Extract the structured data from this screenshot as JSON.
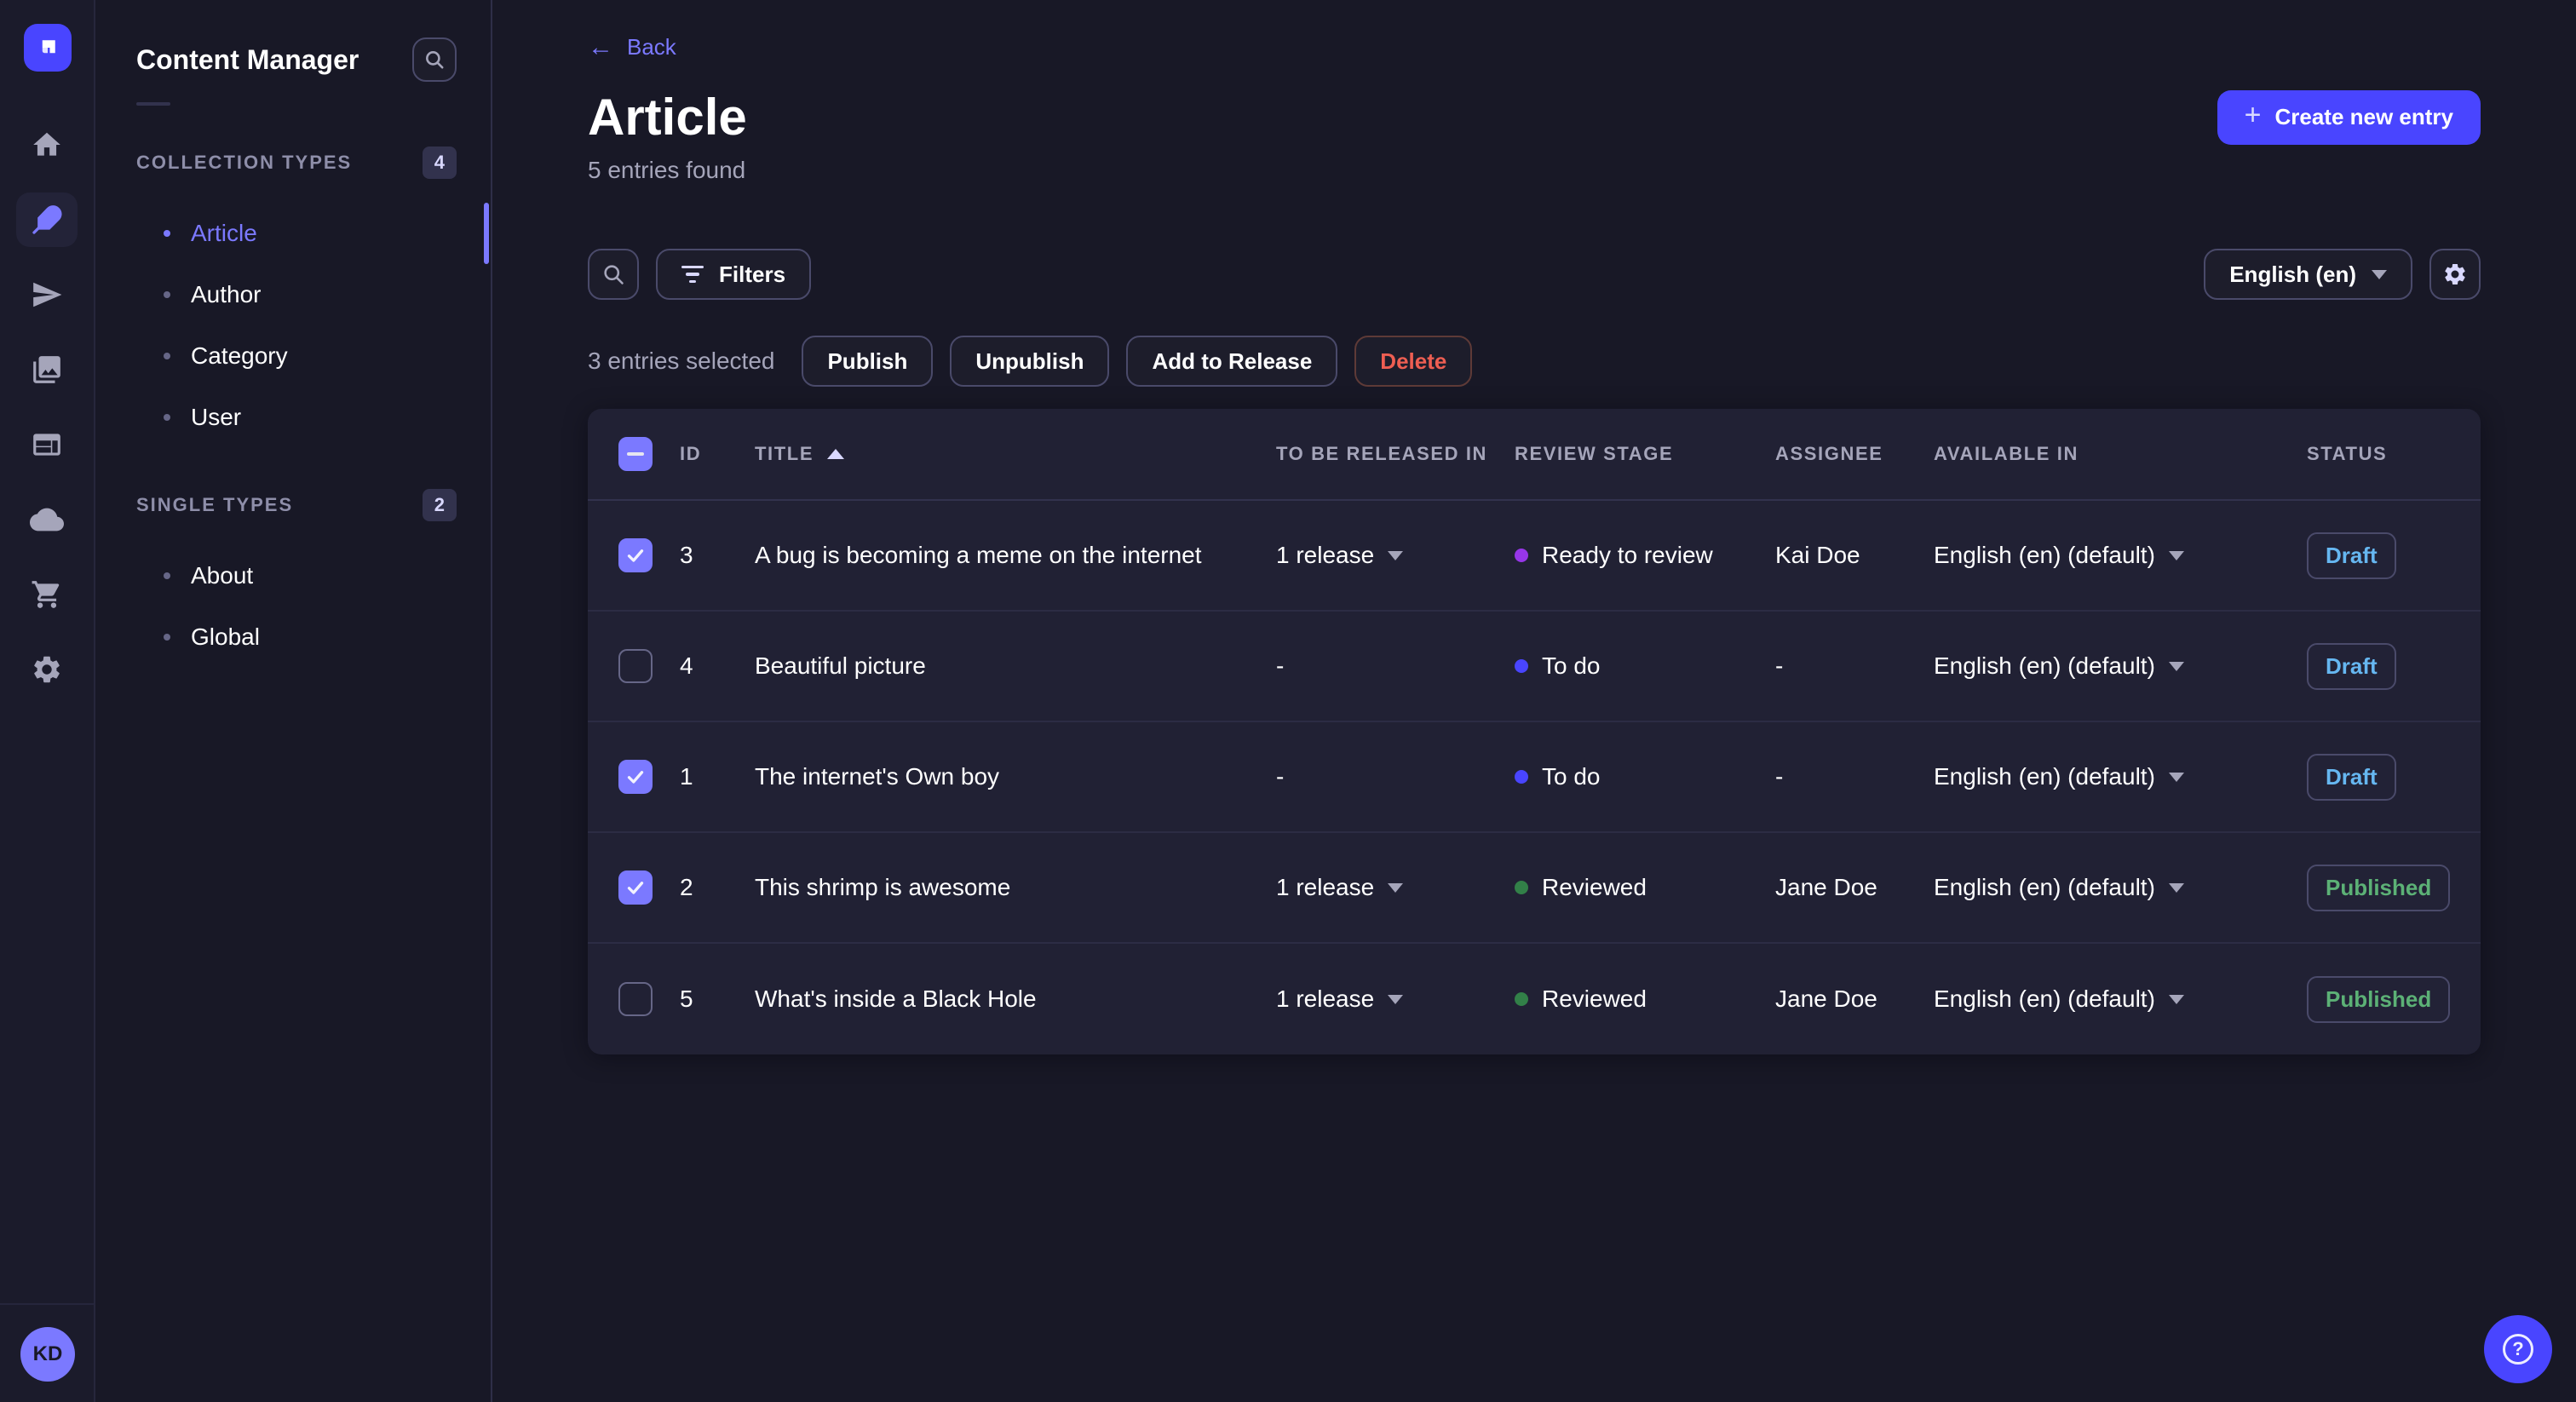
{
  "colors": {
    "accent": "#4945ff",
    "accent_light": "#7b79ff",
    "page_bg": "#181826",
    "card_bg": "#212134",
    "border": "#32324d",
    "text_muted": "#a5a5ba",
    "draft_text": "#66b7f1",
    "published_text": "#5cb176",
    "danger_text": "#ee5e52"
  },
  "nav": {
    "icons": [
      "home",
      "content-manager",
      "releases",
      "media-library",
      "content-type-builder",
      "deploy",
      "marketplace",
      "settings"
    ],
    "active_icon": "content-manager",
    "avatar": "KD"
  },
  "sidebar": {
    "title": "Content Manager",
    "sections": [
      {
        "label": "COLLECTION TYPES",
        "count": "4",
        "items": [
          {
            "label": "Article",
            "active": true
          },
          {
            "label": "Author",
            "active": false
          },
          {
            "label": "Category",
            "active": false
          },
          {
            "label": "User",
            "active": false
          }
        ]
      },
      {
        "label": "SINGLE TYPES",
        "count": "2",
        "items": [
          {
            "label": "About",
            "active": false
          },
          {
            "label": "Global",
            "active": false
          }
        ]
      }
    ]
  },
  "header": {
    "back": "Back",
    "title": "Article",
    "subtitle": "5 entries found",
    "create_button": "Create new entry"
  },
  "toolbar": {
    "filters": "Filters",
    "locale": "English (en)"
  },
  "selection": {
    "text": "3 entries selected",
    "actions": [
      {
        "label": "Publish",
        "danger": false
      },
      {
        "label": "Unpublish",
        "danger": false
      },
      {
        "label": "Add to Release",
        "danger": false
      },
      {
        "label": "Delete",
        "danger": true
      }
    ]
  },
  "table": {
    "columns": [
      "ID",
      "TITLE",
      "TO BE RELEASED IN",
      "REVIEW STAGE",
      "ASSIGNEE",
      "AVAILABLE IN",
      "STATUS"
    ],
    "sort": {
      "column": "TITLE",
      "direction": "asc"
    },
    "header_checkbox": "indeterminate",
    "rows": [
      {
        "checked": true,
        "id": "3",
        "title": "A bug is becoming a meme on the internet",
        "release": "1 release",
        "stage": "Ready to review",
        "stage_color": "#9736e8",
        "assignee": "Kai Doe",
        "locale": "English (en) (default)",
        "status": "Draft",
        "status_color": "#66b7f1"
      },
      {
        "checked": false,
        "id": "4",
        "title": "Beautiful picture",
        "release": "-",
        "stage": "To do",
        "stage_color": "#4945ff",
        "assignee": "-",
        "locale": "English (en) (default)",
        "status": "Draft",
        "status_color": "#66b7f1"
      },
      {
        "checked": true,
        "id": "1",
        "title": "The internet's Own boy",
        "release": "-",
        "stage": "To do",
        "stage_color": "#4945ff",
        "assignee": "-",
        "locale": "English (en) (default)",
        "status": "Draft",
        "status_color": "#66b7f1"
      },
      {
        "checked": true,
        "id": "2",
        "title": "This shrimp is awesome",
        "release": "1 release",
        "stage": "Reviewed",
        "stage_color": "#328048",
        "assignee": "Jane Doe",
        "locale": "English (en) (default)",
        "status": "Published",
        "status_color": "#5cb176"
      },
      {
        "checked": false,
        "id": "5",
        "title": "What's inside a Black Hole",
        "release": "1 release",
        "stage": "Reviewed",
        "stage_color": "#328048",
        "assignee": "Jane Doe",
        "locale": "English (en) (default)",
        "status": "Published",
        "status_color": "#5cb176"
      }
    ]
  },
  "help": {
    "icon": "question-mark"
  }
}
